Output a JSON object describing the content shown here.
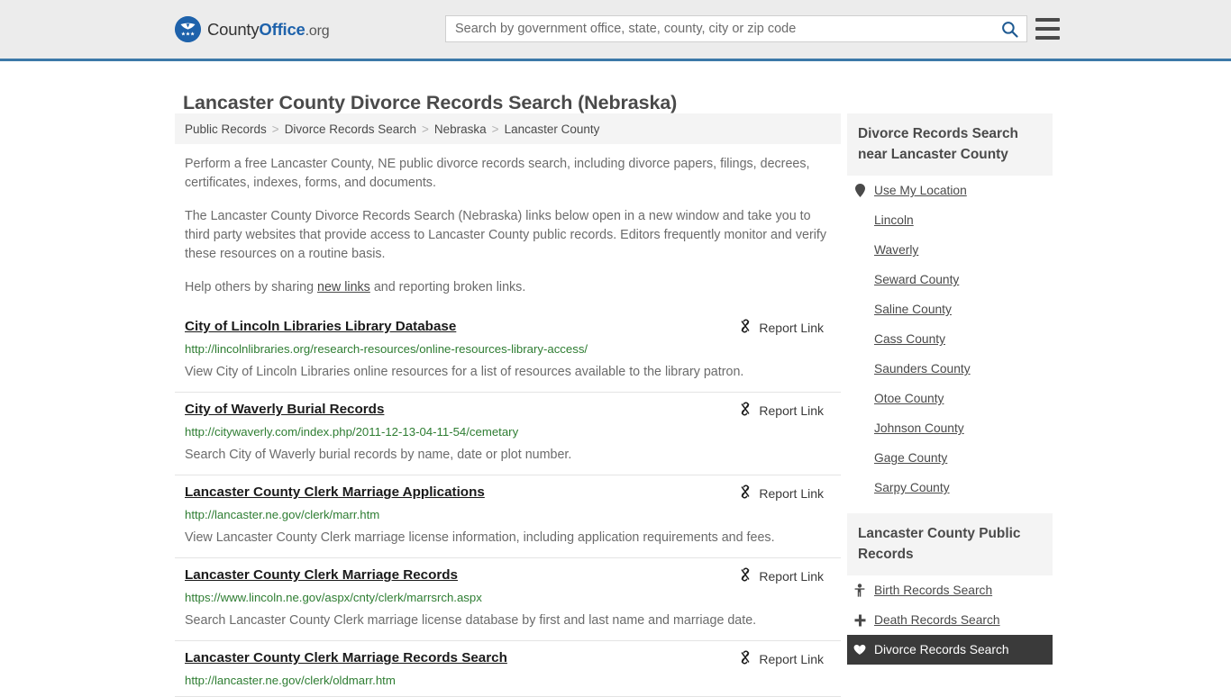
{
  "header": {
    "brand": {
      "part1": "County",
      "part2": "Office",
      "part3": ".org"
    },
    "search": {
      "placeholder": "Search by government office, state, county, city or zip code",
      "value": "",
      "icon": "search-icon"
    },
    "menu_icon": "hamburger-menu-icon",
    "accent_color": "#3c78a8",
    "background_color": "#ececec"
  },
  "page": {
    "title": "Lancaster County Divorce Records Search (Nebraska)"
  },
  "breadcrumb": {
    "items": [
      {
        "label": "Public Records",
        "current": false
      },
      {
        "label": "Divorce Records Search",
        "current": false
      },
      {
        "label": "Nebraska",
        "current": false
      },
      {
        "label": "Lancaster County",
        "current": true
      }
    ],
    "separator": ">"
  },
  "intro": {
    "p1": "Perform a free Lancaster County, NE public divorce records search, including divorce papers, filings, decrees, certificates, indexes, forms, and documents.",
    "p2": "The Lancaster County Divorce Records Search (Nebraska) links below open in a new window and take you to third party websites that provide access to Lancaster County public records. Editors frequently monitor and verify these resources on a routine basis.",
    "p3_before": "Help others by sharing ",
    "p3_link": "new links",
    "p3_after": " and reporting broken links."
  },
  "report_link_label": "Report Link",
  "report_link_icon": "broken-link-icon",
  "results": [
    {
      "title": "City of Lincoln Libraries Library Database",
      "url": "http://lincolnlibraries.org/research-resources/online-resources-library-access/",
      "description": "View City of Lincoln Libraries online resources for a list of resources available to the library patron."
    },
    {
      "title": "City of Waverly Burial Records",
      "url": "http://citywaverly.com/index.php/2011-12-13-04-11-54/cemetary",
      "description": "Search City of Waverly burial records by name, date or plot number."
    },
    {
      "title": "Lancaster County Clerk Marriage Applications",
      "url": "http://lancaster.ne.gov/clerk/marr.htm",
      "description": "View Lancaster County Clerk marriage license information, including application requirements and fees."
    },
    {
      "title": "Lancaster County Clerk Marriage Records",
      "url": "https://www.lincoln.ne.gov/aspx/cnty/clerk/marrsrch.aspx",
      "description": "Search Lancaster County Clerk marriage license database by first and last name and marriage date."
    },
    {
      "title": "Lancaster County Clerk Marriage Records Search",
      "url": "http://lancaster.ne.gov/clerk/oldmarr.htm",
      "description": ""
    }
  ],
  "sidebar": {
    "nearby": {
      "heading": "Divorce Records Search near Lancaster County",
      "items": [
        {
          "label": "Use My Location",
          "icon": "map-pin-icon",
          "active": false
        },
        {
          "label": "Lincoln",
          "icon": "",
          "active": false
        },
        {
          "label": "Waverly",
          "icon": "",
          "active": false
        },
        {
          "label": "Seward County",
          "icon": "",
          "active": false
        },
        {
          "label": "Saline County",
          "icon": "",
          "active": false
        },
        {
          "label": "Cass County",
          "icon": "",
          "active": false
        },
        {
          "label": "Saunders County",
          "icon": "",
          "active": false
        },
        {
          "label": "Otoe County",
          "icon": "",
          "active": false
        },
        {
          "label": "Johnson County",
          "icon": "",
          "active": false
        },
        {
          "label": "Gage County",
          "icon": "",
          "active": false
        },
        {
          "label": "Sarpy County",
          "icon": "",
          "active": false
        }
      ]
    },
    "public_records": {
      "heading": "Lancaster County Public Records",
      "items": [
        {
          "label": "Birth Records Search",
          "icon": "baby-icon",
          "active": false
        },
        {
          "label": "Death Records Search",
          "icon": "cross-icon",
          "active": false
        },
        {
          "label": "Divorce Records Search",
          "icon": "broken-heart-icon",
          "active": true
        }
      ]
    }
  }
}
